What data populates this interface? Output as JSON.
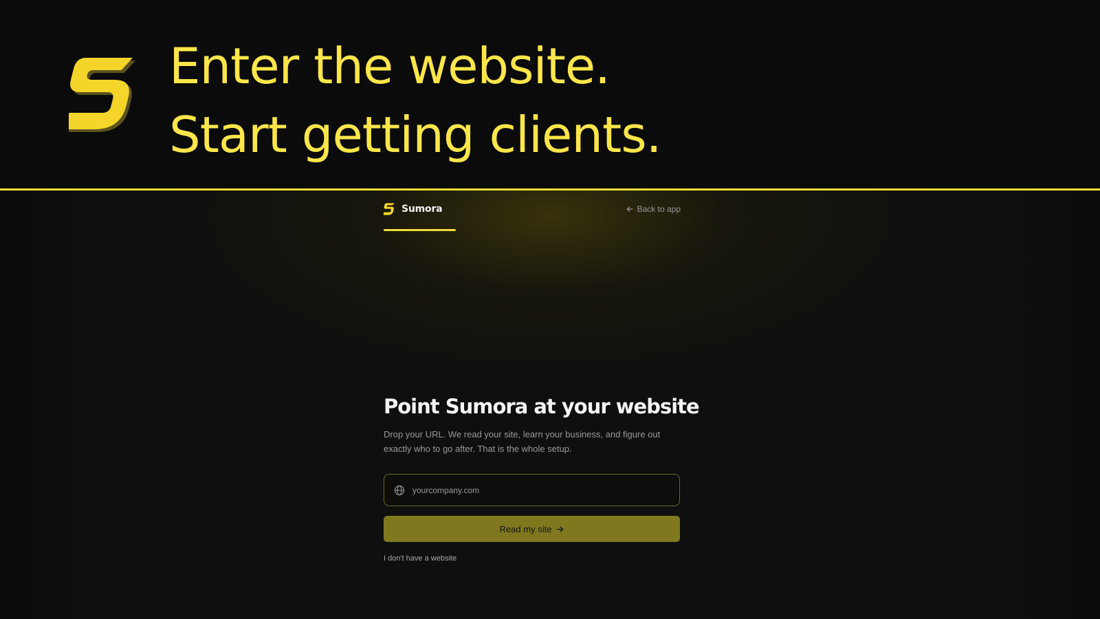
{
  "promo": {
    "headline_line1": "Enter the website.",
    "headline_line2": "Start getting clients.",
    "accent_color": "#fbe64a",
    "logo_icon": "sumora-logo-icon"
  },
  "nav": {
    "brand_name": "Sumora",
    "brand_icon": "sumora-logo-icon",
    "back_label": "Back to app",
    "back_icon": "arrow-left-icon"
  },
  "main": {
    "title": "Point Sumora at your website",
    "subtitle": "Drop your URL. We read your site, learn your business, and figure out exactly who to go after. That is the whole setup.",
    "url_input": {
      "placeholder": "yourcompany.com",
      "value": "",
      "icon": "globe-icon"
    },
    "submit_label": "Read my site",
    "submit_icon": "arrow-right-icon",
    "no_website_label": "I don't have a website"
  },
  "colors": {
    "accent": "#f3dd38",
    "button": "#7f781f",
    "background": "#0b0b0b"
  }
}
